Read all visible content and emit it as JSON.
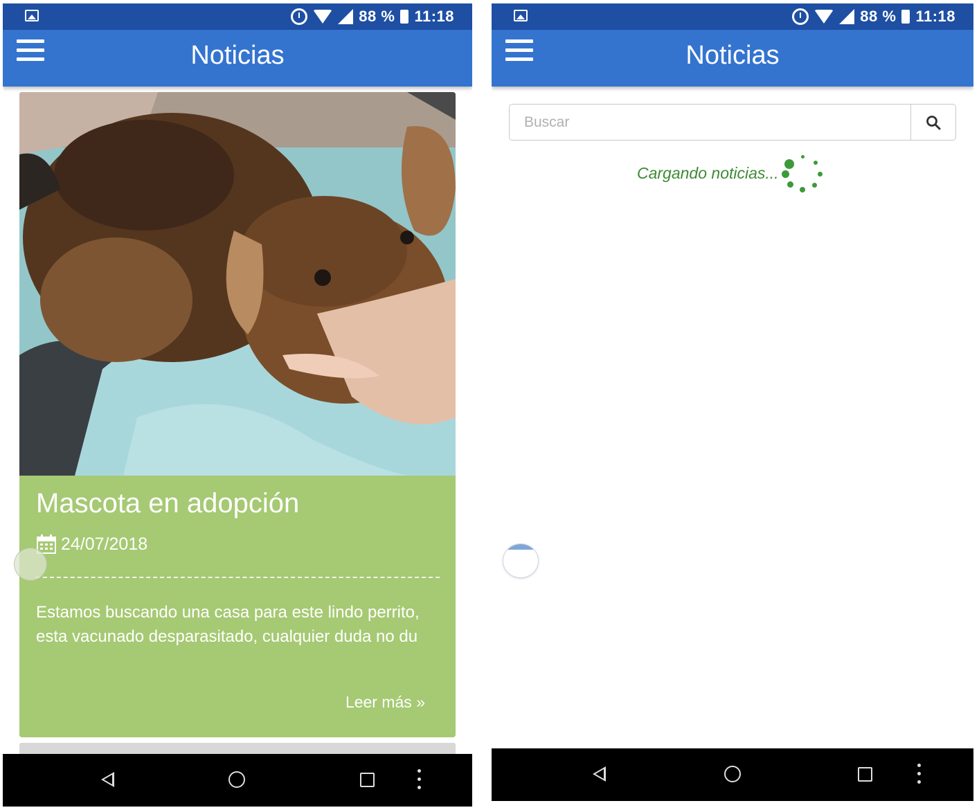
{
  "left_screen": {
    "status_bar": {
      "battery": "88 %",
      "time": "11:18"
    },
    "app_bar": {
      "title": "Noticias"
    },
    "news_card": {
      "title": "Mascota en adopción",
      "date": "24/07/2018",
      "excerpt": "Estamos buscando una casa para este lindo perrito, esta vacunado desparasitado, cualquier duda no du",
      "read_more": "Leer más »"
    }
  },
  "right_screen": {
    "status_bar": {
      "battery": "88 %",
      "time": "11:18"
    },
    "app_bar": {
      "title": "Noticias"
    },
    "search": {
      "placeholder": "Buscar",
      "value": ""
    },
    "loading_text": "Cargando noticias..."
  },
  "colors": {
    "status_bar": "#1e4fa3",
    "app_bar": "#3474cf",
    "card_green": "#a6c973",
    "loading_green": "#3d8a34"
  },
  "icons": [
    "gallery-icon",
    "alarm-icon",
    "wifi-icon",
    "signal-icon",
    "battery-icon",
    "menu-icon",
    "calendar-icon",
    "search-icon",
    "back-icon",
    "home-icon",
    "recents-icon",
    "more-icon",
    "spinner-icon"
  ]
}
